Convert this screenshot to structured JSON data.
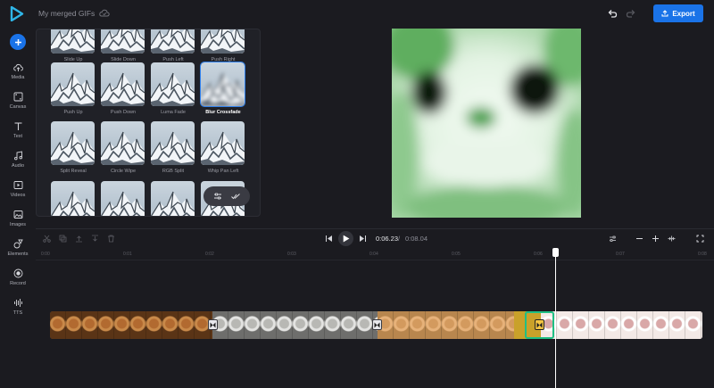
{
  "topbar": {
    "project_title": "My merged GIFs",
    "export_label": "Export"
  },
  "sidebar": {
    "items": [
      {
        "label": "Media",
        "icon": "cloud-upload-icon"
      },
      {
        "label": "Canvas",
        "icon": "canvas-icon"
      },
      {
        "label": "Text",
        "icon": "text-icon"
      },
      {
        "label": "Audio",
        "icon": "music-note-icon"
      },
      {
        "label": "Videos",
        "icon": "video-icon"
      },
      {
        "label": "Images",
        "icon": "image-icon"
      },
      {
        "label": "Elements",
        "icon": "shapes-icon"
      },
      {
        "label": "Record",
        "icon": "record-icon"
      },
      {
        "label": "TTS",
        "icon": "waveform-icon"
      }
    ]
  },
  "transitions": {
    "rows": [
      [
        "Slide Up",
        "Slide Down",
        "Push Left",
        "Push Right"
      ],
      [
        "Push Up",
        "Push Down",
        "Luma Fade",
        "Blur Crossfade"
      ],
      [
        "Split Reveal",
        "Circle Wipe",
        "RGB Split",
        "Whip Pan Left"
      ]
    ],
    "selected": "Blur Crossfade"
  },
  "player": {
    "current_time": "0:06.23",
    "separator": "/",
    "total_time": "0:08.04"
  },
  "ruler": {
    "ticks": [
      "0:00",
      "0:01",
      "0:02",
      "0:03",
      "0:04",
      "0:05",
      "0:06",
      "0:07",
      "0:08"
    ]
  },
  "colors": {
    "accent": "#1a73e8",
    "selection": "#1fbf84",
    "active_transition": "#f5c542"
  }
}
